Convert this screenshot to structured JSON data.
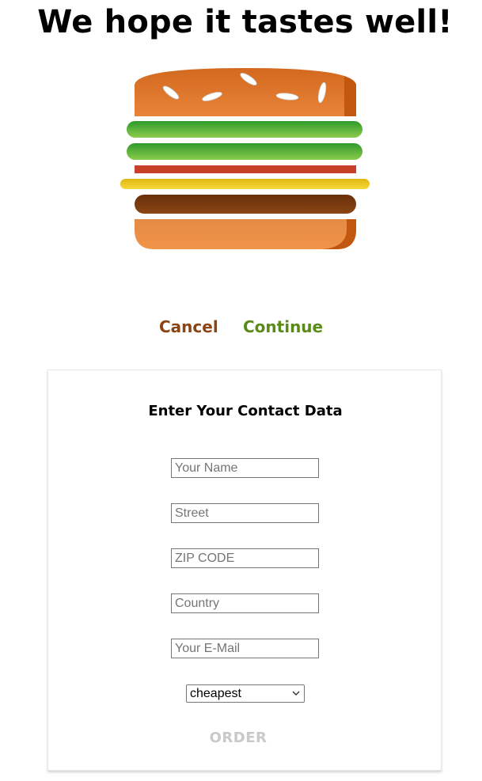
{
  "headline": "We hope it tastes well!",
  "burger": {
    "icons": [
      "burger-top-bun",
      "lettuce",
      "lettuce",
      "tomato",
      "cheese",
      "patty",
      "burger-bottom-bun"
    ],
    "colors": {
      "bun": "#e0792e",
      "bun_shadow": "#c35f16",
      "lettuce": "#5cb531",
      "tomato": "#c9402a",
      "cheese": "#f1c81b",
      "patty": "#7a3a0c",
      "seeds": "#ffffff"
    }
  },
  "controls": {
    "cancel_label": "Cancel",
    "continue_label": "Continue"
  },
  "form": {
    "title": "Enter Your Contact Data",
    "fields": [
      {
        "placeholder": "Your Name",
        "value": ""
      },
      {
        "placeholder": "Street",
        "value": ""
      },
      {
        "placeholder": "ZIP CODE",
        "value": ""
      },
      {
        "placeholder": "Country",
        "value": ""
      },
      {
        "placeholder": "Your E-Mail",
        "value": ""
      }
    ],
    "delivery_method": {
      "selected": "cheapest"
    },
    "order_label": "ORDER"
  },
  "colors": {
    "cancel": "#8a4513",
    "continue": "#5a8a17",
    "order_disabled": "#c9c9c9"
  }
}
